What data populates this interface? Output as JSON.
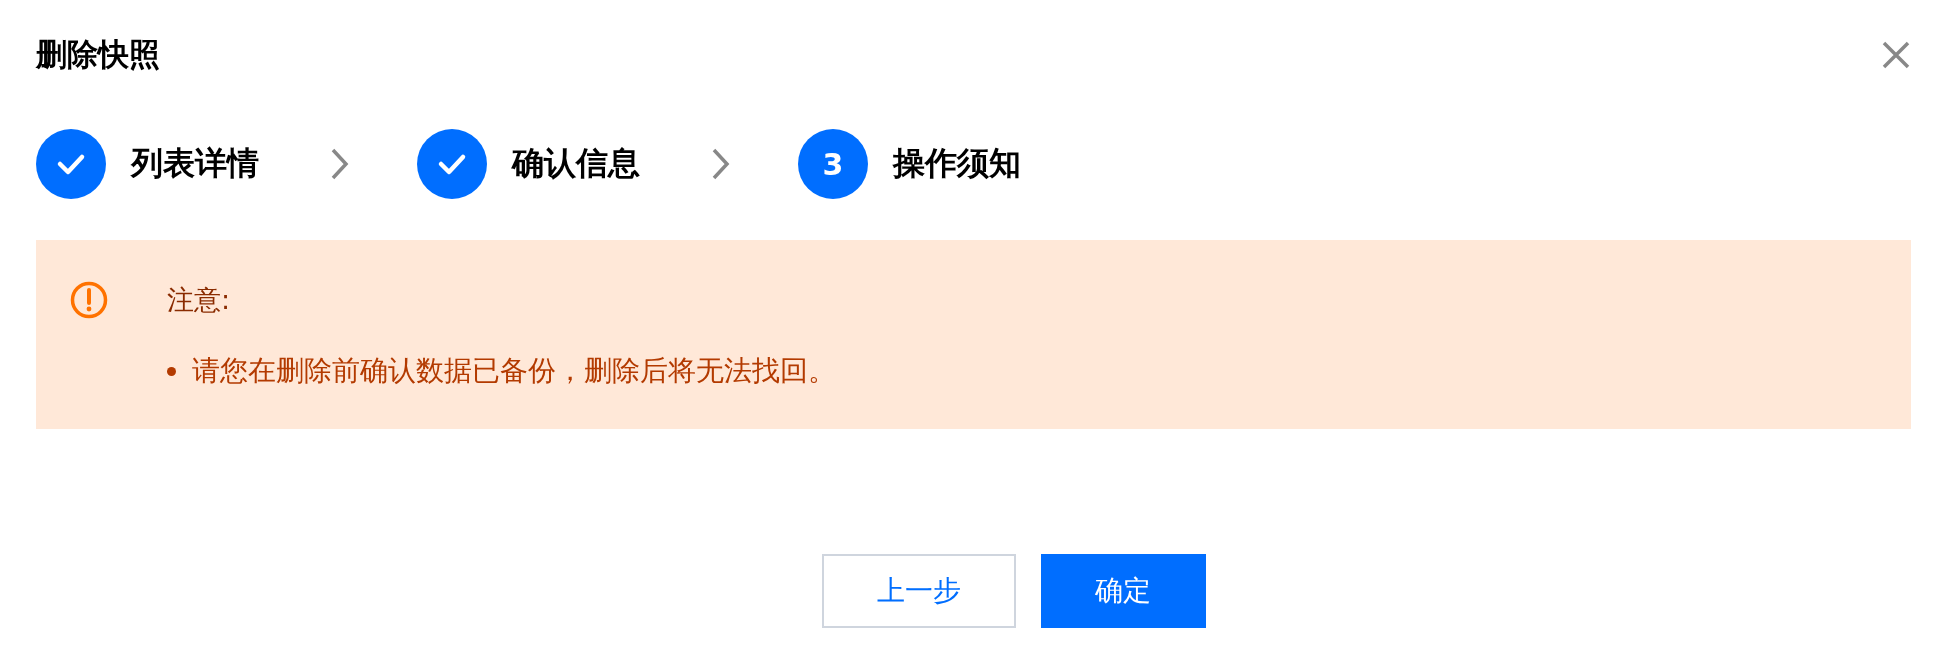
{
  "dialog": {
    "title": "删除快照"
  },
  "steps": [
    {
      "kind": "done",
      "label": "列表详情"
    },
    {
      "kind": "done",
      "label": "确认信息"
    },
    {
      "kind": "current",
      "number": "3",
      "label": "操作须知"
    }
  ],
  "alert": {
    "title": "注意:",
    "items": [
      "请您在删除前确认数据已备份，删除后将无法找回。"
    ]
  },
  "buttons": [
    {
      "kind": "secondary",
      "label": "上一步"
    },
    {
      "kind": "primary",
      "label": "确定"
    }
  ]
}
